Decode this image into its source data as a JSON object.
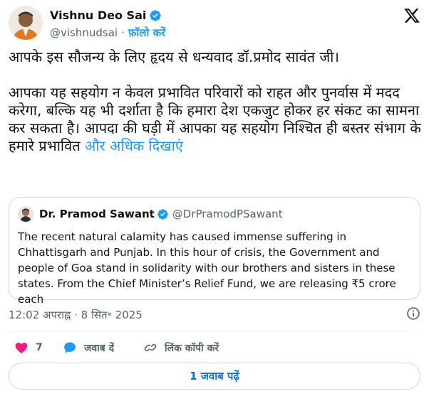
{
  "author": {
    "name": "Vishnu Deo Sai",
    "handle": "@vishnudsai",
    "separator": "·",
    "follow_label": "फ़ॉलो करें",
    "verified": true
  },
  "tweet": {
    "paragraph_1": "आपके इस सौजन्य के लिए हृदय से धन्यवाद डॉ.प्रमोद सावंत जी।",
    "paragraph_2": "आपका यह सहयोग न केवल प्रभावित परिवारों को राहत और पुनर्वास में मदद करेगा, बल्कि यह भी दर्शाता है कि हमारा देश एकजुट होकर हर संकट का सामना कर सकता है। आपदा की घड़ी में आपका यह सहयोग निश्चित ही बस्तर संभाग के हमारे प्रभावित ",
    "show_more": "और अधिक दिखाएं"
  },
  "quoted": {
    "name": "Dr. Pramod Sawant",
    "handle": "@DrPramodPSawant",
    "text": "The recent natural calamity has caused immense suffering in Chhattisgarh and Punjab. In this hour of crisis, the Government and people of Goa stand in solidarity with our brothers and sisters in these states. From the Chief Minister’s Relief Fund, we are releasing ₹5 crore each"
  },
  "meta": {
    "timestamp": "12:02 अपराह्न · 8 सित॰ 2025"
  },
  "actions": {
    "like_count": "7",
    "reply_label": "जवाब दें",
    "copy_link_label": "लिंक कॉपी करें"
  },
  "replies_button": "1 जवाब पढ़ें",
  "colors": {
    "accent": "#1d9bf0",
    "like": "#f91880",
    "link_blue": "#006fd6",
    "muted": "#536471",
    "border": "#cfd9de"
  },
  "icons": {
    "verified": "verified-badge-icon",
    "x_logo": "x-logo-icon",
    "info": "info-icon",
    "like": "heart-icon",
    "reply": "speech-bubble-icon",
    "copy_link": "link-icon"
  }
}
